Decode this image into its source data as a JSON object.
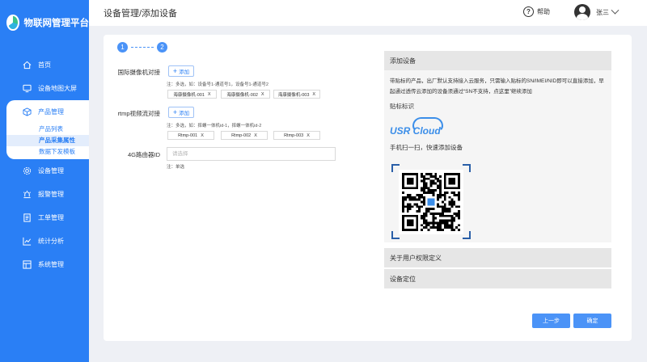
{
  "sidebar": {
    "brand": "物联网管理平台",
    "items": [
      {
        "label": "首页",
        "icon": "home-icon"
      },
      {
        "label": "设备地图大屏",
        "icon": "monitor-icon"
      },
      {
        "label": "产品管理",
        "icon": "cube-icon"
      },
      {
        "label": "设备管理",
        "icon": "gear-icon"
      },
      {
        "label": "报警管理",
        "icon": "alarm-icon"
      },
      {
        "label": "工单管理",
        "icon": "document-icon"
      },
      {
        "label": "统计分析",
        "icon": "chart-icon"
      },
      {
        "label": "系统管理",
        "icon": "grid-icon"
      }
    ],
    "submenu": [
      "产品列表",
      "产品采集属性",
      "数据下发模板"
    ]
  },
  "header": {
    "breadcrumb": "设备管理/添加设备",
    "help": "帮助",
    "user": "张三"
  },
  "steps": [
    "1",
    "2"
  ],
  "form": {
    "camera": {
      "label": "国际摄像机对接",
      "add": "添加",
      "note": "注：多选，如：设备号1-通道号1，设备号1-通道号2",
      "chips": [
        "海康摄像机-001",
        "海康摄像机-002",
        "海康摄像机-003"
      ]
    },
    "rtmp": {
      "label": "rtmp视频流对接",
      "add": "添加",
      "note": "注：多选，如：摔螺一体机id-1，摔螺一体机id-2",
      "chips": [
        "Rtmp-001",
        "Rtmp-002",
        "Rtmp-003"
      ]
    },
    "router": {
      "label": "4G路由器ID",
      "placeholder": "请选择",
      "note": "注：单选"
    }
  },
  "panel": {
    "add_title": "添加设备",
    "desc": "带贴标的产品，出厂默认支持接入云服务，只需输入贴标的SN/IMEI/NID即可以直接添加，早起通过透传云添加的设备须通过“SN不支持，点这里”继续添加",
    "sticker": "贴标标识",
    "logo_text": "USR Cloud",
    "scan": "手机扫一扫，快速添加设备",
    "permission": "关于用户权限定义",
    "location": "设备定位"
  },
  "buttons": {
    "prev": "上一步",
    "confirm": "确定"
  },
  "colors": {
    "sidebar": "#2a7ff5",
    "accent": "#4b93f7",
    "background": "#eef0f5"
  }
}
